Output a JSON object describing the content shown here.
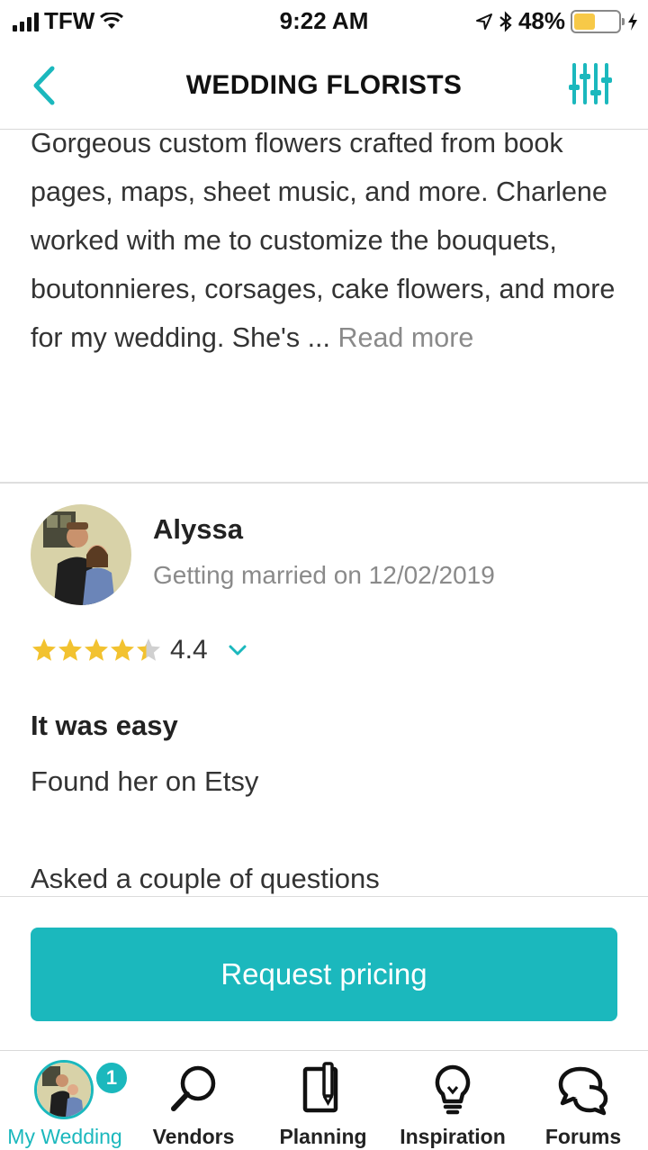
{
  "status_bar": {
    "carrier": "TFW",
    "time": "9:22 AM",
    "battery_percent": "48%",
    "battery_level": 0.48
  },
  "nav": {
    "title": "WEDDING FLORISTS",
    "back_icon": "chevron-left-icon",
    "filter_icon": "sliders-icon"
  },
  "description": {
    "text": "Gorgeous custom flowers crafted from book pages, maps, sheet music, and more. Charlene worked with me to customize the bouquets, boutonnieres, corsages, cake flowers, and more for my wedding. She's ...",
    "read_more": "Read more"
  },
  "review": {
    "reviewer_name": "Alyssa",
    "reviewer_subtitle": "Getting married on 12/02/2019",
    "rating_value": "4.4",
    "rating": 4.4,
    "title": "It was easy",
    "body_line1": "Found her on Etsy",
    "body_line2": "Asked a couple of questions"
  },
  "cta": {
    "label": "Request pricing"
  },
  "tabs": [
    {
      "label": "My Wedding",
      "icon": "avatar",
      "badge": "1",
      "active": true
    },
    {
      "label": "Vendors",
      "icon": "search-icon"
    },
    {
      "label": "Planning",
      "icon": "notebook-icon"
    },
    {
      "label": "Inspiration",
      "icon": "lightbulb-icon"
    },
    {
      "label": "Forums",
      "icon": "chat-bubbles-icon"
    }
  ],
  "colors": {
    "accent": "#1bb8bd",
    "star": "#f2c230",
    "battery": "#f7c948"
  }
}
